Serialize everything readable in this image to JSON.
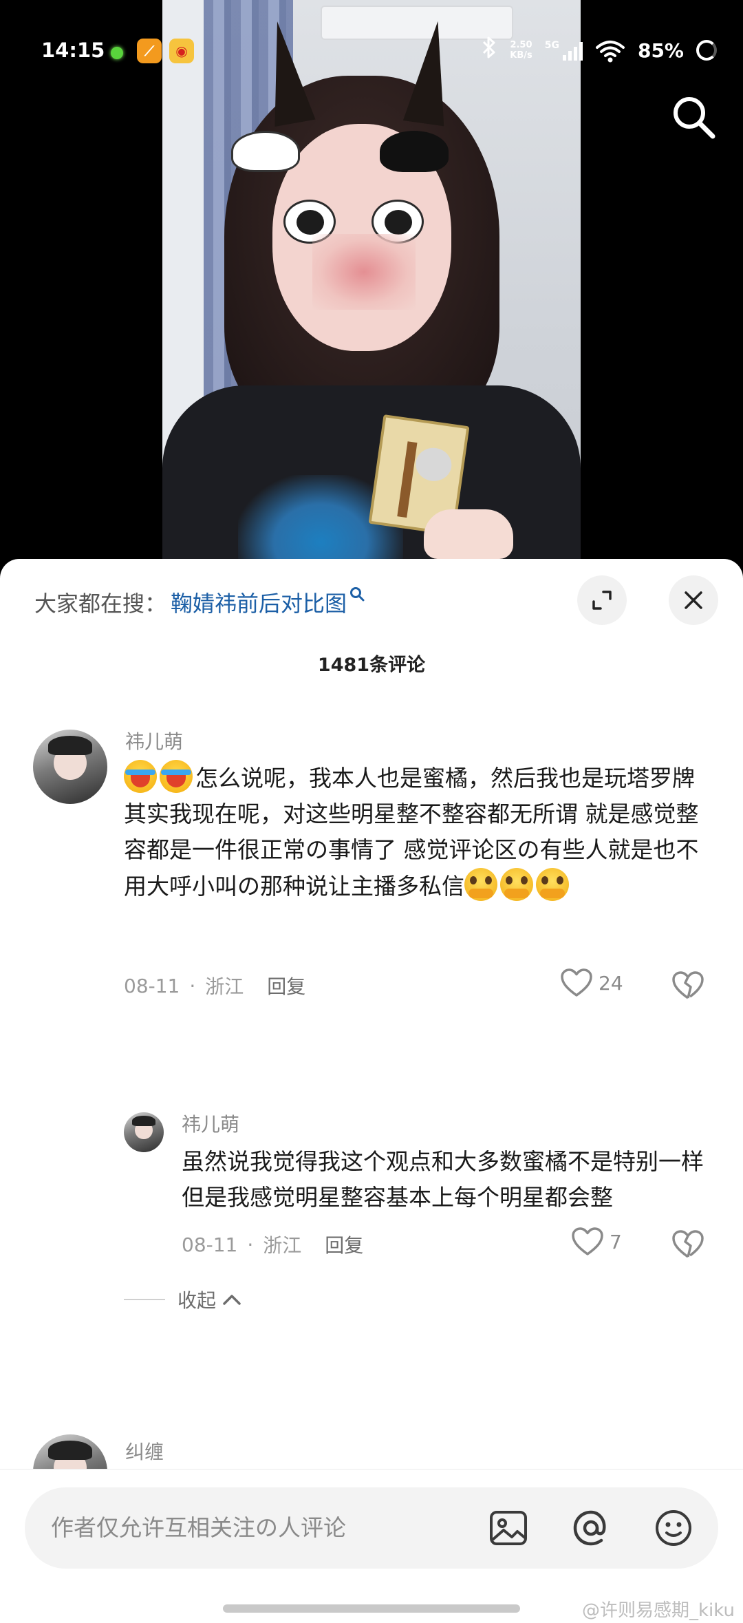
{
  "status_bar": {
    "time": "14:15",
    "net_speed_value": "2.50",
    "net_speed_unit": "KB/s",
    "network_type": "5G",
    "battery": "85%"
  },
  "sheet": {
    "hot_search_label": "大家都在搜：",
    "hot_search_term": "鞠婧祎前后对比图",
    "comment_count": "1481条评论"
  },
  "comments": [
    {
      "name": "祎儿萌",
      "text": "怎么说呢，我本人也是蜜橘，然后我也是玩塔罗牌　其实我现在呢，对这些明星整不整容都无所谓  就是感觉整容都是一件很正常の事情了  感觉评论区の有些人就是也不用大呼小叫の那种说让主播多私信",
      "date": "08-11",
      "location": "浙江",
      "reply_label": "回复",
      "likes": "24",
      "replies": [
        {
          "name": "祎儿萌",
          "text": "虽然说我觉得我这个观点和大多数蜜橘不是特别一样  但是我感觉明星整容基本上每个明星都会整",
          "date": "08-11",
          "location": "浙江",
          "reply_label": "回复",
          "likes": "7"
        }
      ],
      "collapse_label": "收起"
    },
    {
      "name": "纠缠"
    }
  ],
  "input": {
    "placeholder": "作者仅允许互相关注の人评论"
  },
  "watermark": "@许则易感期_kiku",
  "colors": {
    "link_blue": "#1c5fa6",
    "meta_gray": "#9a9a9a"
  }
}
